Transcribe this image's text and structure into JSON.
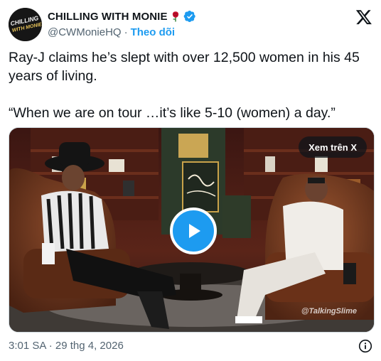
{
  "author": {
    "display_name": "CHILLING WITH MONIE",
    "handle": "@CWMonieHQ",
    "separator": "·",
    "follow_label": "Theo dõi",
    "avatar_text": "CHILLING WITH MONIE"
  },
  "tweet": {
    "paragraphs": [
      "Ray-J claims he’s slept with over 12,500 women in his 45 years of living.",
      "“When we are on tour …it’s like 5-10 (women) a day.”"
    ]
  },
  "media": {
    "watch_label": "Xem trên X",
    "watermark": "@TalkingSlime"
  },
  "footer": {
    "timestamp": "3:01 SA · 29 thg 4, 2026"
  },
  "colors": {
    "accent": "#1d9bf0",
    "text_primary": "#0f1419",
    "text_secondary": "#536471",
    "rose": "#c8102e"
  },
  "icons": [
    "rose-icon",
    "verified-icon",
    "x-logo-icon",
    "play-icon",
    "info-icon"
  ]
}
